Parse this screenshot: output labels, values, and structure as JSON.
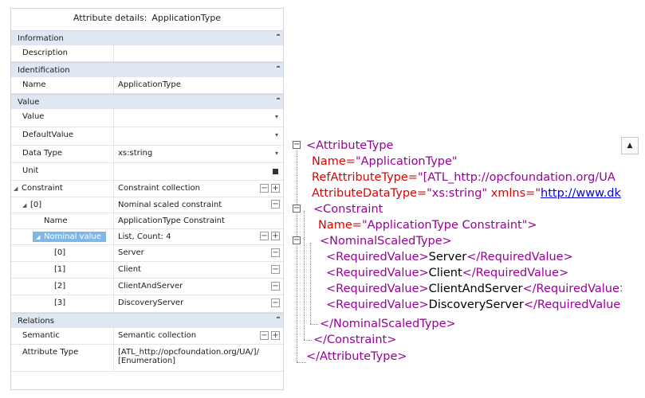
{
  "panel": {
    "title_label": "Attribute details:",
    "title_value": "ApplicationType",
    "sections": {
      "information": "Information",
      "identification": "Identification",
      "value": "Value",
      "relations": "Relations"
    },
    "collapse_icon": "double-chevron-up",
    "rows": {
      "description": {
        "name": "Description",
        "value": ""
      },
      "name": {
        "name": "Name",
        "value": "ApplicationType"
      },
      "value": {
        "name": "Value",
        "value": ""
      },
      "default_value": {
        "name": "DefaultValue",
        "value": ""
      },
      "data_type": {
        "name": "Data Type",
        "value": "xs:string"
      },
      "unit": {
        "name": "Unit",
        "value": ""
      },
      "constraint": {
        "name": "Constraint",
        "value": "Constraint collection"
      },
      "constraint_0": {
        "name": "[0]",
        "value": "Nominal scaled constraint"
      },
      "constraint_name": {
        "name": "Name",
        "value": "ApplicationType Constraint"
      },
      "nominal_value": {
        "name": "Nominal value",
        "value": "List, Count: 4"
      },
      "nv": [
        {
          "name": "[0]",
          "value": "Server"
        },
        {
          "name": "[1]",
          "value": "Client"
        },
        {
          "name": "[2]",
          "value": "ClientAndServer"
        },
        {
          "name": "[3]",
          "value": "DiscoveryServer"
        }
      ],
      "semantic": {
        "name": "Semantic",
        "value": "Semantic collection"
      },
      "attribute_type": {
        "name": "Attribute Type",
        "value_line1": "[ATL_http://opcfoundation.org/UA/]/",
        "value_line2": "[Enumeration]"
      }
    }
  },
  "xml": {
    "attr_open": "<AttributeType",
    "name_attr": "Name=",
    "name_val": "\"ApplicationType\"",
    "ref_attr": "RefAttributeType=",
    "ref_val": "\"[ATL_http://opcfoundation.org/UA",
    "dt_attr": "AttributeDataType=",
    "dt_val": "\"xs:string\"",
    "xmlns_attr": " xmlns=",
    "xmlns_q": "\"",
    "xmlns_link": "http://www.dk",
    "constraint_open": "<Constraint",
    "cname_attr": "Name=",
    "cname_val": "\"ApplicationType Constraint\"",
    "close_bracket": ">",
    "nst_open": "<NominalScaledType>",
    "rv_open": "<RequiredValue>",
    "rv_close": "</RequiredValue>",
    "rv_values": [
      "Server",
      "Client",
      "ClientAndServer",
      "DiscoveryServer"
    ],
    "nst_close": "</NominalScaledType>",
    "constraint_close": "</Constraint>",
    "attr_close": "</AttributeType>",
    "toggle_symbol": "−",
    "scroll_up_icon": "▲"
  }
}
